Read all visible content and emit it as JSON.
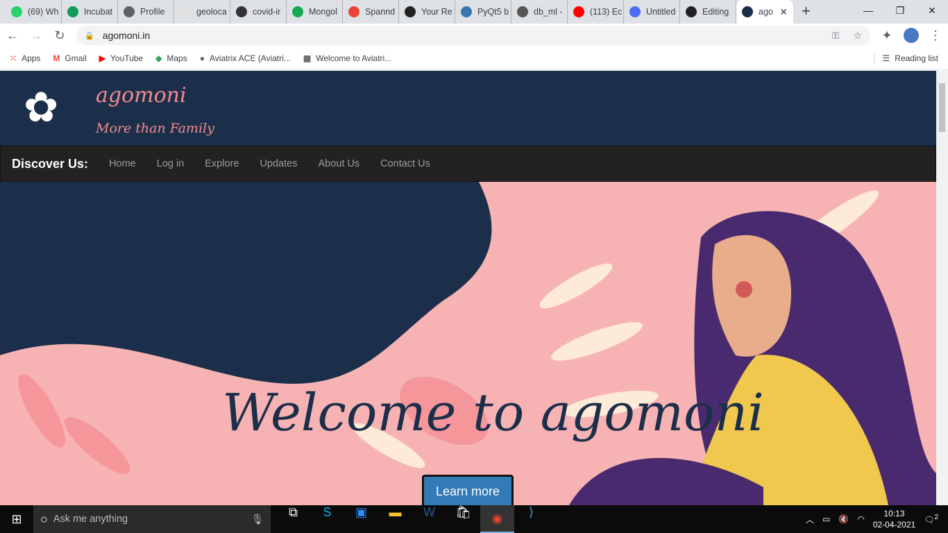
{
  "browser": {
    "tabs": [
      {
        "label": "(69) Wh",
        "color": "#25d366",
        "badge": "69"
      },
      {
        "label": "Incubat",
        "color": "#0f9d58"
      },
      {
        "label": "Profile",
        "color": "#5f6368"
      },
      {
        "label": "geoloca",
        "color": "#e0e0e0"
      },
      {
        "label": "covid-ir",
        "color": "#333"
      },
      {
        "label": "Mongol",
        "color": "#13aa52"
      },
      {
        "label": "Spannd",
        "color": "#ea4335"
      },
      {
        "label": "Your Re",
        "color": "#222"
      },
      {
        "label": "PyQt5 b",
        "color": "#3776ab"
      },
      {
        "label": "db_ml -",
        "color": "#555"
      },
      {
        "label": "(113) Ec",
        "color": "#ff0000"
      },
      {
        "label": "Untitled",
        "color": "#4a6cf7"
      },
      {
        "label": "Editing",
        "color": "#222"
      },
      {
        "label": "ago",
        "color": "#1c2f4a"
      }
    ],
    "url": "agomoni.in",
    "bookmarks": [
      "Apps",
      "Gmail",
      "YouTube",
      "Maps",
      "Aviatrix ACE (Aviatri...",
      "Welcome to Aviatri..."
    ],
    "reading_list": "Reading list"
  },
  "site": {
    "brand": "agomoni",
    "tagline": "More than Family",
    "nav_title": "Discover Us:",
    "nav": [
      "Home",
      "Log in",
      "Explore",
      "Updates",
      "About Us",
      "Contact Us"
    ],
    "welcome": "Welcome to agomoni",
    "cta": "Learn more"
  },
  "taskbar": {
    "search_placeholder": "Ask me anything",
    "time": "10:13",
    "date": "02-04-2021",
    "notifications": "2"
  }
}
